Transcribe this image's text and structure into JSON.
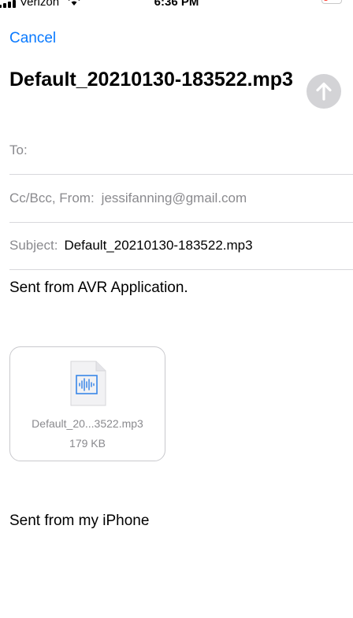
{
  "status_bar": {
    "carrier": "Verizon",
    "time": "6:36 PM",
    "battery_color": "#ff3b30"
  },
  "nav": {
    "cancel_label": "Cancel",
    "send_icon": "arrow-up-icon"
  },
  "compose": {
    "title": "Default_20210130-183522.mp3",
    "to_label": "To:",
    "cc_label": "Cc/Bcc, From:",
    "from_value": "jessifanning@gmail.com",
    "subject_label": "Subject:",
    "subject_value": "Default_20210130-183522.mp3",
    "body_text": "Sent from AVR Application.",
    "signature": "Sent from my iPhone"
  },
  "attachment": {
    "icon": "audio-file-icon",
    "name": "Default_20...3522.mp3",
    "size": "179 KB"
  },
  "colors": {
    "accent": "#0a7aff",
    "send_disabled": "#d3d3d6"
  }
}
